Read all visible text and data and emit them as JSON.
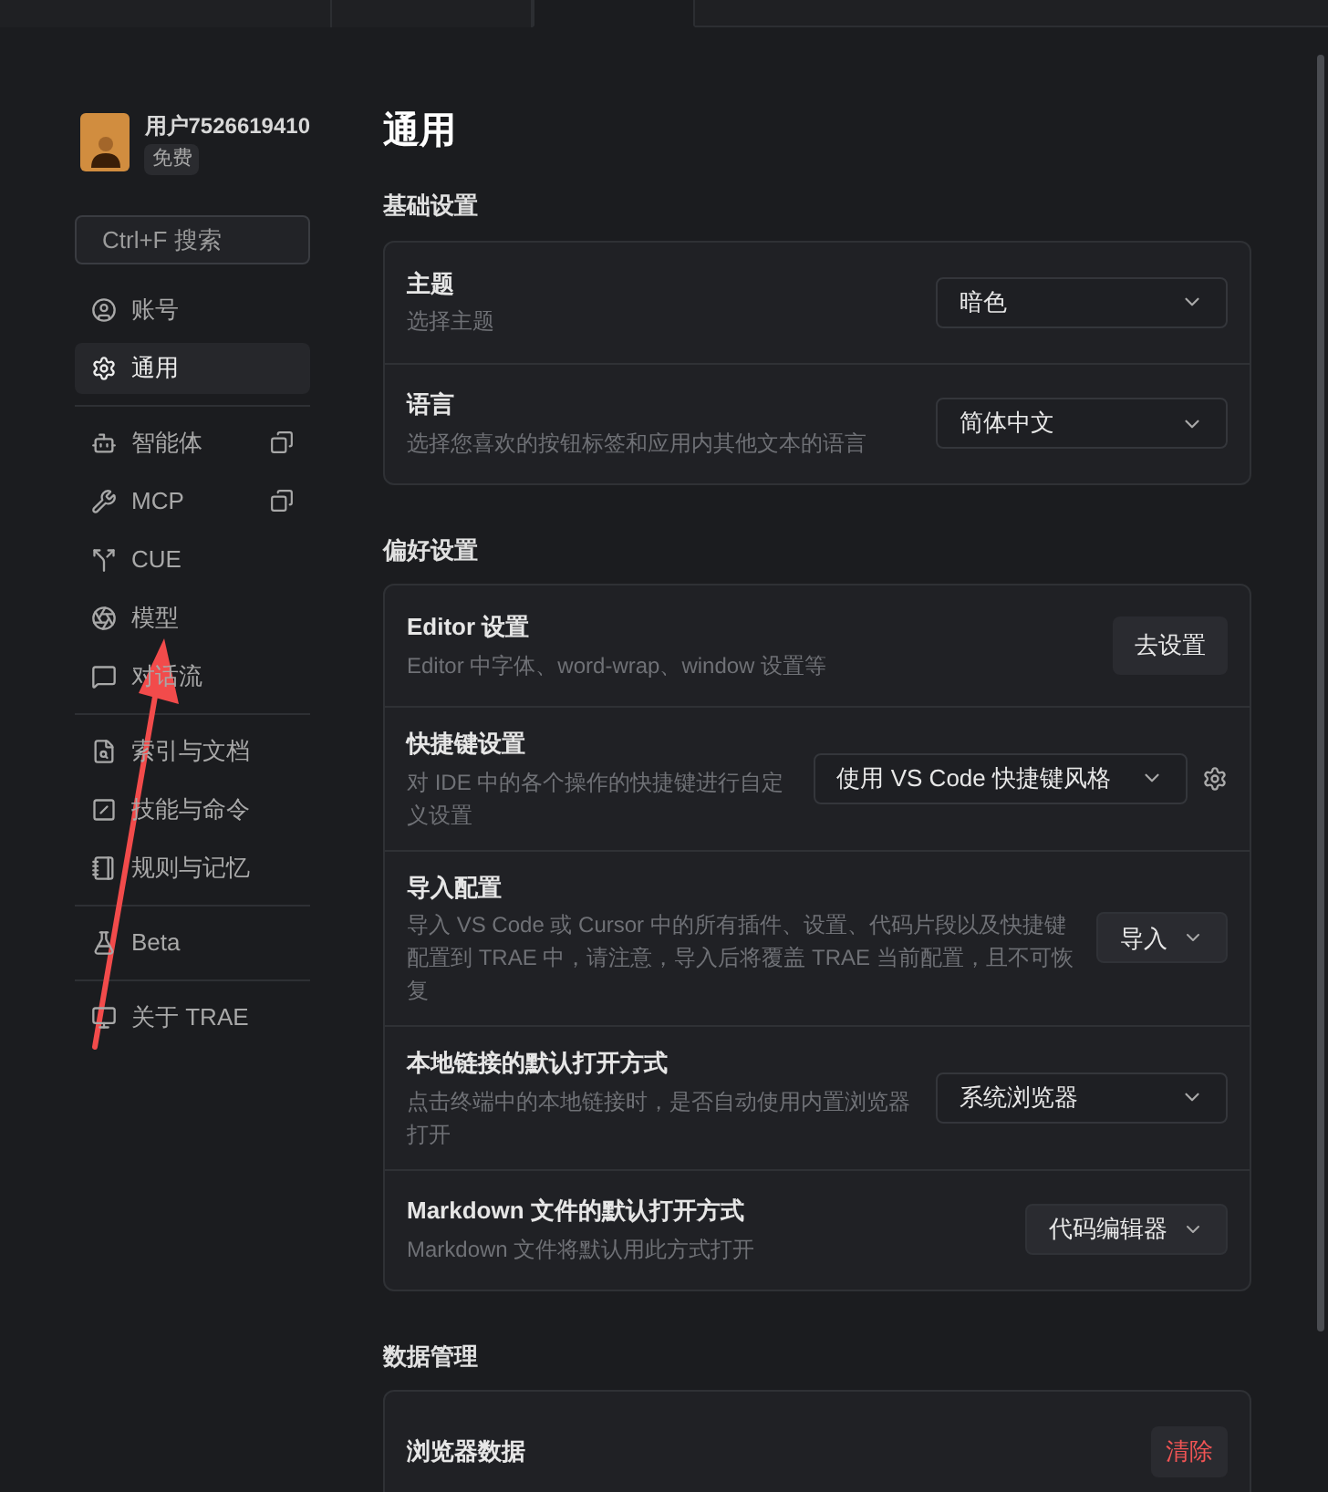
{
  "tabs": [
    {
      "selected": false
    },
    {
      "selected": false
    },
    {
      "selected": true
    }
  ],
  "sidebar": {
    "user": {
      "name": "用户7526619410",
      "plan": "免费"
    },
    "search": {
      "placeholder": "Ctrl+F 搜索"
    },
    "groups": [
      [
        {
          "label": "账号",
          "selected": false,
          "external": false
        },
        {
          "label": "通用",
          "selected": true,
          "external": false
        }
      ],
      [
        {
          "label": "智能体",
          "selected": false,
          "external": true
        },
        {
          "label": "MCP",
          "selected": false,
          "external": true
        },
        {
          "label": "CUE",
          "selected": false,
          "external": false
        },
        {
          "label": "模型",
          "selected": false,
          "external": false
        },
        {
          "label": "对话流",
          "selected": false,
          "external": false
        }
      ],
      [
        {
          "label": "索引与文档",
          "selected": false,
          "external": false
        },
        {
          "label": "技能与命令",
          "selected": false,
          "external": false
        },
        {
          "label": "规则与记忆",
          "selected": false,
          "external": false
        }
      ],
      [
        {
          "label": "Beta",
          "selected": false,
          "external": false
        }
      ],
      [
        {
          "label": "关于 TRAE",
          "selected": false,
          "external": false
        }
      ]
    ]
  },
  "page_title": "通用",
  "sections": [
    {
      "title": "基础设置",
      "rows": [
        {
          "title": "主题",
          "description": "选择主题",
          "kind": "select",
          "value": "暗色"
        },
        {
          "title": "语言",
          "description": "选择您喜欢的按钮标签和应用内其他文本的语言",
          "kind": "select",
          "value": "简体中文"
        }
      ]
    },
    {
      "title": "偏好设置",
      "rows": [
        {
          "title": "Editor 设置",
          "description": "Editor 中字体、word-wrap、window 设置等",
          "kind": "button",
          "value": "去设置"
        },
        {
          "title": "快捷键设置",
          "description": "对 IDE 中的各个操作的快捷键进行自定义设置",
          "kind": "select-gear",
          "value": "使用 VS Code 快捷键风格"
        },
        {
          "title": "导入配置",
          "description": "导入 VS Code 或 Cursor 中的所有插件、设置、代码片段以及快捷键配置到 TRAE 中，请注意，导入后将覆盖 TRAE 当前配置，且不可恢复",
          "kind": "menu-button",
          "value": "导入"
        },
        {
          "title": "本地链接的默认打开方式",
          "description": "点击终端中的本地链接时，是否自动使用内置浏览器打开",
          "kind": "select",
          "value": "系统浏览器"
        },
        {
          "title": "Markdown 文件的默认打开方式",
          "description": "Markdown 文件将默认用此方式打开",
          "kind": "menu-button",
          "value": "代码编辑器"
        }
      ]
    },
    {
      "title": "数据管理",
      "rows": [
        {
          "title": "浏览器数据",
          "kind": "danger",
          "value": "清除"
        }
      ]
    }
  ]
}
